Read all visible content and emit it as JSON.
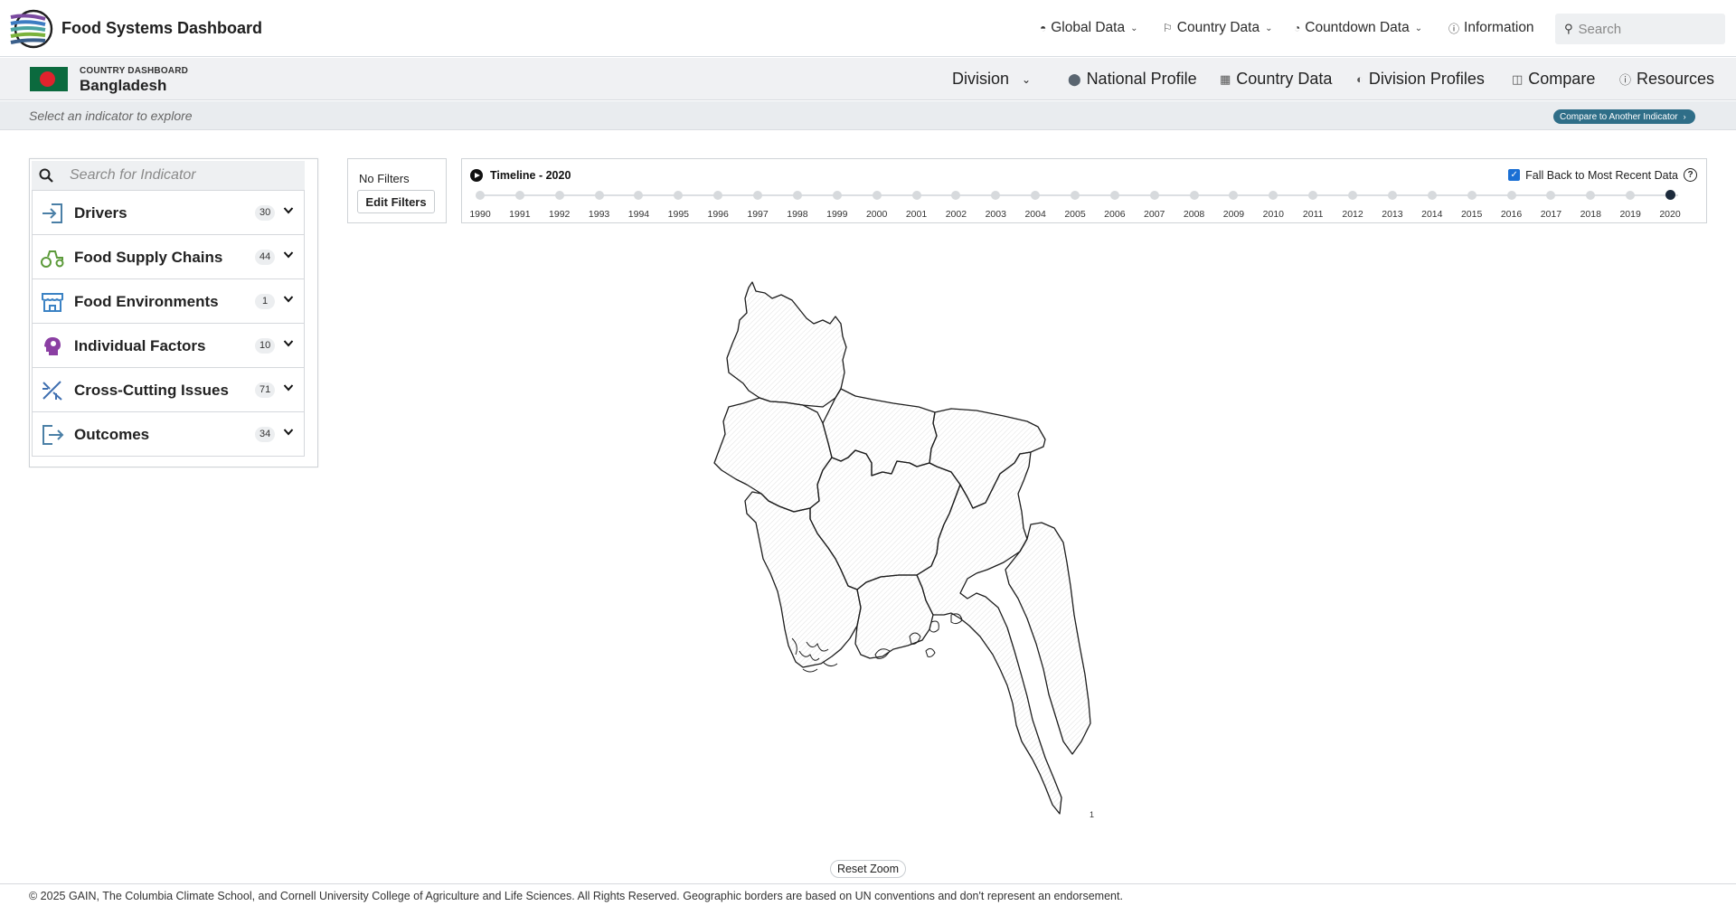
{
  "header": {
    "brand": "Food Systems Dashboard",
    "nav": [
      {
        "label": "Global Data",
        "icon": "globe-icon",
        "has_caret": true
      },
      {
        "label": "Country Data",
        "icon": "flag-icon",
        "has_caret": true
      },
      {
        "label": "Countdown Data",
        "icon": "countdown-icon",
        "has_caret": true
      },
      {
        "label": "Information",
        "icon": "info-icon",
        "has_caret": false
      }
    ],
    "search_placeholder": "Search"
  },
  "country": {
    "label": "COUNTRY DASHBOARD",
    "name": "Bangladesh",
    "flag_colors": {
      "field": "#0b6a3e",
      "disc": "#e1222d"
    },
    "nav": {
      "division": "Division",
      "national_profile": "National Profile",
      "country_data": "Country Data",
      "division_profiles": "Division Profiles",
      "compare": "Compare",
      "resources": "Resources"
    }
  },
  "subbar": {
    "hint": "Select an indicator to explore",
    "compare_button": "Compare to Another Indicator"
  },
  "indicators": {
    "search_placeholder": "Search for Indicator",
    "items": [
      {
        "label": "Drivers",
        "count": "30",
        "icon": "drivers-icon",
        "color": "#4a7fa6"
      },
      {
        "label": "Food Supply Chains",
        "count": "44",
        "icon": "tractor-icon",
        "color": "#5c9a3a"
      },
      {
        "label": "Food Environments",
        "count": "1",
        "icon": "store-icon",
        "color": "#3b82c4"
      },
      {
        "label": "Individual Factors",
        "count": "10",
        "icon": "person-head-icon",
        "color": "#8b3fa3"
      },
      {
        "label": "Cross-Cutting Issues",
        "count": "71",
        "icon": "cross-cutting-icon",
        "color": "#3f6fb0"
      },
      {
        "label": "Outcomes",
        "count": "34",
        "icon": "outcomes-icon",
        "color": "#4a7fa6"
      }
    ]
  },
  "filters": {
    "status": "No Filters",
    "edit_button": "Edit Filters"
  },
  "timeline": {
    "title": "Timeline - 2020",
    "fallback_label": "Fall Back to Most Recent Data",
    "fallback_checked": true,
    "years": [
      "1990",
      "1991",
      "1992",
      "1993",
      "1994",
      "1995",
      "1996",
      "1997",
      "1998",
      "1999",
      "2000",
      "2001",
      "2002",
      "2003",
      "2004",
      "2005",
      "2006",
      "2007",
      "2008",
      "2009",
      "2010",
      "2011",
      "2012",
      "2013",
      "2014",
      "2015",
      "2016",
      "2017",
      "2018",
      "2019",
      "2020"
    ],
    "selected_year": "2020"
  },
  "map": {
    "reset_zoom": "Reset Zoom",
    "scale_label": "1"
  },
  "footer": {
    "text": "© 2025 GAIN, The Columbia Climate School, and Cornell University College of Agriculture and Life Sciences. All Rights Reserved. Geographic borders are based on UN conventions and don't represent an endorsement."
  }
}
